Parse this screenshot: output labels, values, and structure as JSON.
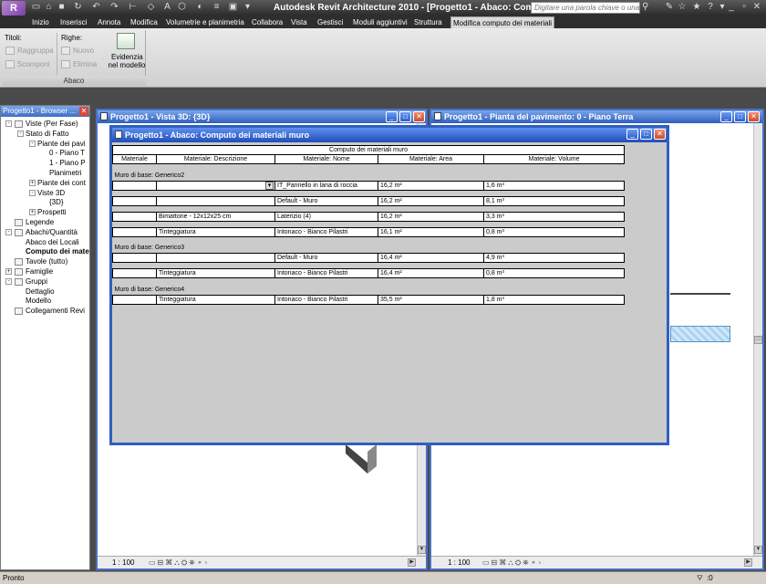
{
  "app": {
    "logo": "R",
    "title": "Autodesk Revit Architecture 2010 - [Progetto1 - Abaco: Com...",
    "search_placeholder": "Digitare una parola chiave o una fr..."
  },
  "menu": [
    "Inizio",
    "Inserisci",
    "Annota",
    "Modifica",
    "Volumetrie e planimetria",
    "Collabora",
    "Vista",
    "Gestisci",
    "Moduli aggiuntivi",
    "Struttura",
    "Modifica computo dei materiali"
  ],
  "ribbon": {
    "titoli_label": "Titoli:",
    "raggruppa": "Raggruppa",
    "scomponi": "Scomponi",
    "righe_label": "Righe:",
    "nuovo": "Nuovo",
    "elimina": "Elimina",
    "evidenzia_line1": "Evidenzia",
    "evidenzia_line2": "nel modello",
    "panel_name": "Abaco"
  },
  "browser": {
    "title": "Progetto1 - Browser ...",
    "items": [
      {
        "label": "Viste (Per Fase)",
        "level": 0,
        "exp": "-",
        "icon": true
      },
      {
        "label": "Stato di Fatto",
        "level": 1,
        "exp": "-",
        "icon": false
      },
      {
        "label": "Piante dei pavi",
        "level": 2,
        "exp": "-",
        "icon": false
      },
      {
        "label": "0 - Piano T",
        "level": 3,
        "exp": "",
        "icon": false
      },
      {
        "label": "1 - Piano P",
        "level": 3,
        "exp": "",
        "icon": false
      },
      {
        "label": "Planimetri",
        "level": 3,
        "exp": "",
        "icon": false
      },
      {
        "label": "Piante dei cont",
        "level": 2,
        "exp": "+",
        "icon": false
      },
      {
        "label": "Viste 3D",
        "level": 2,
        "exp": "-",
        "icon": false
      },
      {
        "label": "{3D}",
        "level": 3,
        "exp": "",
        "icon": false
      },
      {
        "label": "Prospetti",
        "level": 2,
        "exp": "+",
        "icon": false
      },
      {
        "label": "Legende",
        "level": 0,
        "exp": "",
        "icon": true
      },
      {
        "label": "Abachi/Quantità",
        "level": 0,
        "exp": "-",
        "icon": true
      },
      {
        "label": "Abaco dei Locali",
        "level": 1,
        "exp": "",
        "icon": false
      },
      {
        "label": "Computo dei mate",
        "level": 1,
        "exp": "",
        "icon": false,
        "bold": true
      },
      {
        "label": "Tavole (tutto)",
        "level": 0,
        "exp": "",
        "icon": true
      },
      {
        "label": "Famiglie",
        "level": 0,
        "exp": "+",
        "icon": true
      },
      {
        "label": "Gruppi",
        "level": 0,
        "exp": "-",
        "icon": true
      },
      {
        "label": "Dettaglio",
        "level": 1,
        "exp": "",
        "icon": false
      },
      {
        "label": "Modello",
        "level": 1,
        "exp": "",
        "icon": false
      },
      {
        "label": "Collegamenti Revi",
        "level": 0,
        "exp": "",
        "icon": true
      }
    ]
  },
  "view3d": {
    "title": "Progetto1 - Vista 3D: {3D}",
    "scale": "1 : 100"
  },
  "floorplan": {
    "title": "Progetto1 - Pianta del pavimento: 0 - Piano Terra",
    "scale": "1 : 100"
  },
  "schedule": {
    "title": "Progetto1 - Abaco: Computo dei materiali muro",
    "table_title": "Computo dei materiali muro",
    "columns": [
      "Materiale",
      "Materiale: Descrizione",
      "Materiale: Nome",
      "Materiale: Area",
      "Materiale: Volume"
    ],
    "groups": [
      {
        "header": "Muro di base: Generico2",
        "rows": [
          [
            "",
            "",
            "IT_Pannello in lana di roccia",
            "16,2 m²",
            "1,6 m³"
          ],
          [
            "",
            "",
            "Default - Muro",
            "16,2 m²",
            "8,1 m³"
          ],
          [
            "",
            "Bimattone - 12x12x25 cm",
            "Laterizio (4)",
            "16,2 m²",
            "3,3 m³"
          ],
          [
            "",
            "Tinteggiatura",
            "Intonaco - Bianco Pilastri",
            "16,1 m²",
            "0,8 m³"
          ]
        ]
      },
      {
        "header": "Muro di base: Generico3",
        "rows": [
          [
            "",
            "",
            "Default - Muro",
            "16,4 m²",
            "4,9 m³"
          ],
          [
            "",
            "Tinteggiatura",
            "Intonaco - Bianco Pilastri",
            "16,4 m²",
            "0,8 m³"
          ]
        ]
      },
      {
        "header": "Muro di base: Generico4",
        "rows": [
          [
            "",
            "Tinteggiatura",
            "Intonaco - Bianco Pilastri",
            "35,5 m²",
            "1,8 m³"
          ]
        ]
      }
    ]
  },
  "status": {
    "text": "Pronto",
    "filter": ":0"
  }
}
